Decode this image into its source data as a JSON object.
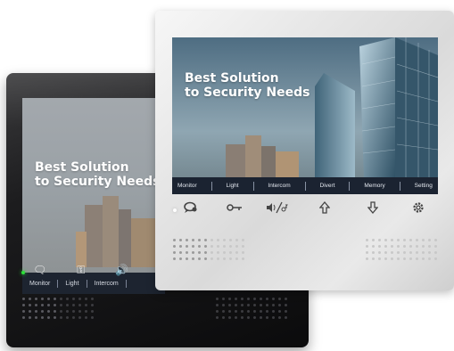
{
  "headline": {
    "line1": "Best Solution",
    "line2": "to Security Needs"
  },
  "front_menu": [
    "Monitor",
    "Light",
    "Intercom",
    "Divert",
    "Memory",
    "Setting"
  ],
  "back_menu": [
    "Monitor",
    "Light",
    "Intercom"
  ],
  "buttons": {
    "talk": "talk-icon",
    "unlock": "key-icon",
    "volume_ring": "volume-ring-icon",
    "up": "arrow-up-icon",
    "down": "arrow-down-icon",
    "settings": "gear-icon"
  },
  "colors": {
    "front_body": "#e5e5e5",
    "back_body": "#141416",
    "menu_bar": "#1b2331",
    "led_green": "#2ddf3a"
  }
}
